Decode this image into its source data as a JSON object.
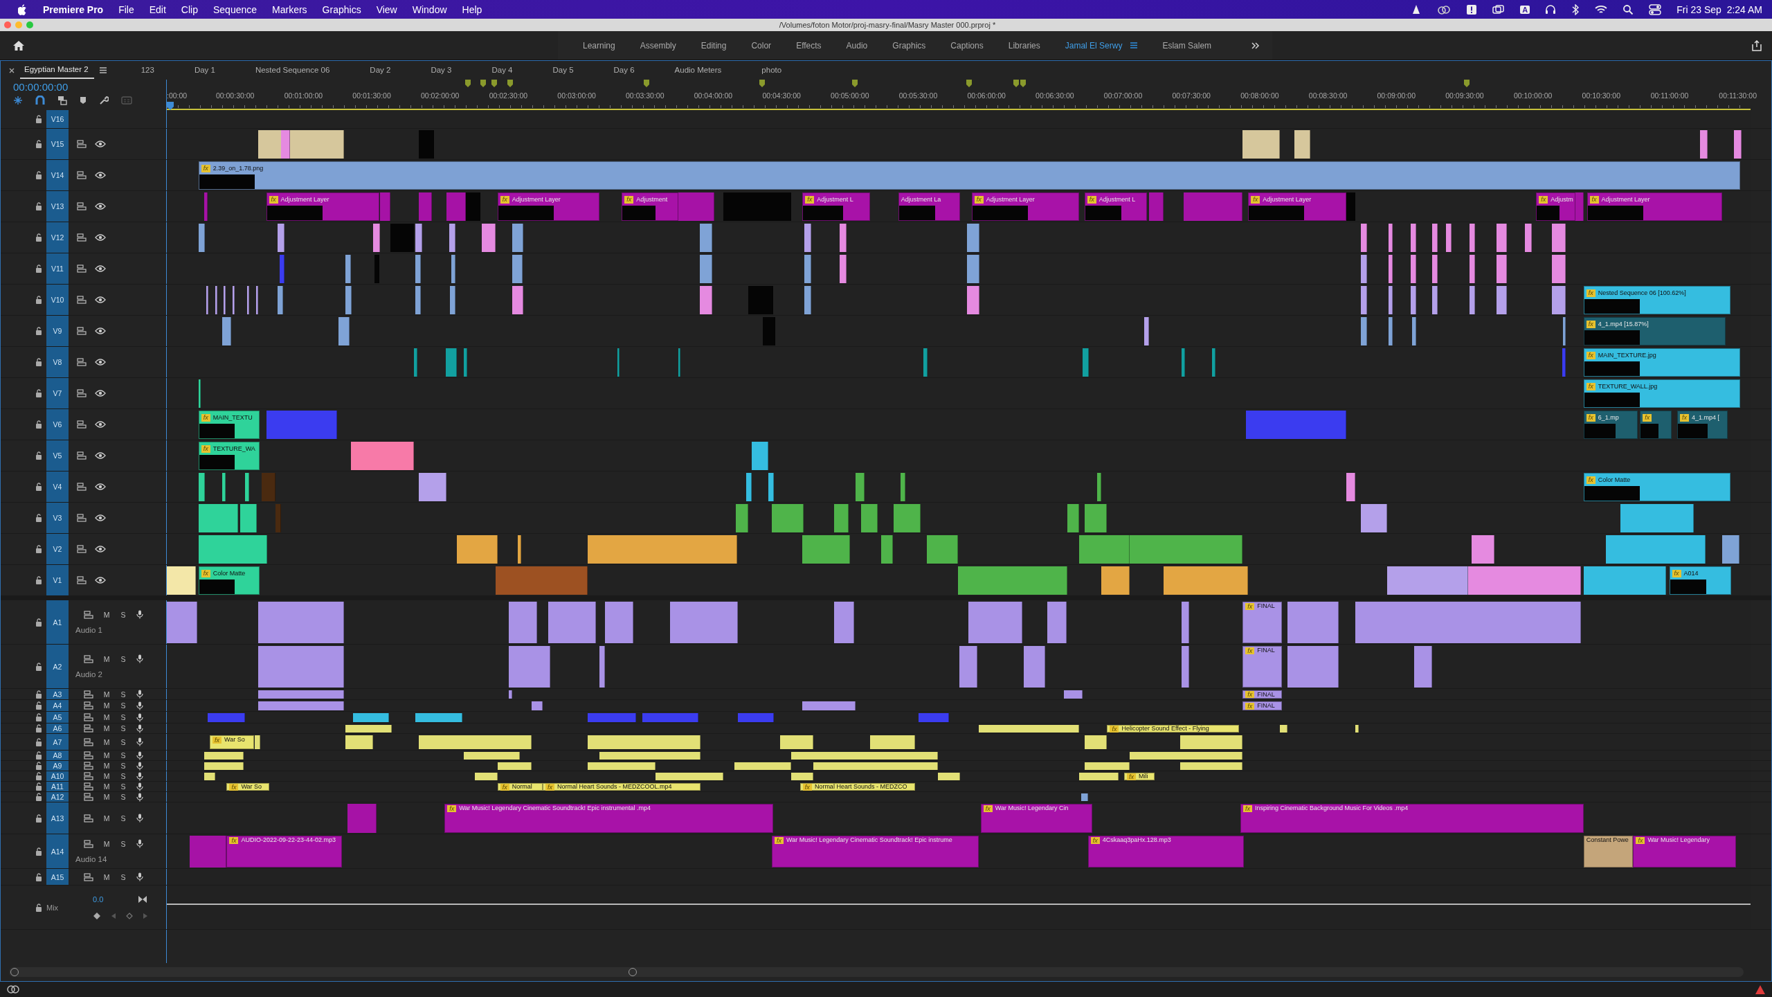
{
  "menu_bar": {
    "app": "Premiere Pro",
    "items": [
      "File",
      "Edit",
      "Clip",
      "Sequence",
      "Markers",
      "Graphics",
      "View",
      "Window",
      "Help"
    ],
    "input_source": "A",
    "clock": "Fri 23 Sep  2:24 AM"
  },
  "window": {
    "title": "/Volumes/foton Motor/proj-masry-final/Masry Master 000.prproj *"
  },
  "workspaces": [
    {
      "label": "Learning",
      "selected": false
    },
    {
      "label": "Assembly",
      "selected": false
    },
    {
      "label": "Editing",
      "selected": false
    },
    {
      "label": "Color",
      "selected": false
    },
    {
      "label": "Effects",
      "selected": false
    },
    {
      "label": "Audio",
      "selected": false
    },
    {
      "label": "Graphics",
      "selected": false
    },
    {
      "label": "Captions",
      "selected": false
    },
    {
      "label": "Libraries",
      "selected": false
    },
    {
      "label": "Jamal El Serwy",
      "selected": true
    },
    {
      "label": "Eslam Salem",
      "selected": false
    }
  ],
  "sequence_tabs": [
    {
      "label": "Egyptian Master 2",
      "selected": true
    },
    {
      "label": "123",
      "selected": false
    },
    {
      "label": "Day 1",
      "selected": false
    },
    {
      "label": "Nested Sequence 06",
      "selected": false
    },
    {
      "label": "Day 2",
      "selected": false
    },
    {
      "label": "Day 3",
      "selected": false
    },
    {
      "label": "Day 4",
      "selected": false
    },
    {
      "label": "Day 5",
      "selected": false
    },
    {
      "label": "Day 6",
      "selected": false
    },
    {
      "label": "Audio Meters",
      "selected": false
    },
    {
      "label": "photo",
      "selected": false
    }
  ],
  "timecode": "00:00:00:00",
  "ruler": [
    ":00:00",
    "00:00:30:00",
    "00:01:00:00",
    "00:01:30:00",
    "00:02:00:00",
    "00:02:30:00",
    "00:03:00:00",
    "00:03:30:00",
    "00:04:00:00",
    "00:04:30:00",
    "00:05:00:00",
    "00:05:30:00",
    "00:06:00:00",
    "00:06:30:00",
    "00:07:00:00",
    "00:07:30:00",
    "00:08:00:00",
    "00:08:30:00",
    "00:09:00:00",
    "00:09:30:00",
    "00:10:00:00",
    "00:10:30:00",
    "00:11:00:00",
    "00:11:30:00"
  ],
  "video_tracks": [
    {
      "label": "V16"
    },
    {
      "label": "V15"
    },
    {
      "label": "V14",
      "clips": [
        {
          "label": "2.39_on_1.78.png",
          "fx": "fx",
          "color": "#7ea1d4"
        }
      ]
    },
    {
      "label": "V13",
      "clips": [
        {
          "label": "Adjustment Layer",
          "fx": "fx",
          "color": "#a812a8"
        },
        {
          "label": "Adjustment Layer",
          "fx": "fx",
          "color": "#a812a8"
        },
        {
          "label": "Adjustment",
          "fx": "fx",
          "color": "#a812a8"
        },
        {
          "label": "Adjustment L",
          "fx": "fx",
          "color": "#a812a8"
        },
        {
          "label": "Adjustment La",
          "color": "#a812a8"
        },
        {
          "label": "Adjustment Layer",
          "fx": "fx",
          "color": "#a812a8"
        },
        {
          "label": "Adjustment L",
          "fx": "fx",
          "color": "#a812a8"
        },
        {
          "label": "Adjustment Layer",
          "fx": "fx",
          "color": "#a812a8"
        },
        {
          "label": "Adjustm",
          "fx": "fx",
          "color": "#a812a8"
        },
        {
          "label": "Adjustment Layer",
          "fx": "fx",
          "color": "#a812a8"
        }
      ]
    },
    {
      "label": "V12"
    },
    {
      "label": "V11"
    },
    {
      "label": "V10",
      "clips": [
        {
          "label": "Nested Sequence 06 [100.62%]",
          "fx": "fx",
          "color": "#35bde0"
        }
      ]
    },
    {
      "label": "V9",
      "clips": [
        {
          "label": "4_1.mp4 [15.87%]",
          "fx": "fx",
          "color": "#1e5f6e"
        }
      ]
    },
    {
      "label": "V8",
      "clips": [
        {
          "label": "MAIN_TEXTURE.jpg",
          "fx": "fx",
          "color": "#35bde0"
        }
      ]
    },
    {
      "label": "V7",
      "clips": [
        {
          "label": "TEXTURE_WALL.jpg",
          "fx": "fx",
          "color": "#35bde0"
        }
      ]
    },
    {
      "label": "V6",
      "clips": [
        {
          "label": "MAIN_TEXTU",
          "fx": "fx",
          "color": "#2fd39a"
        },
        {
          "label": "6_1.mp",
          "fx": "fx",
          "color": "#1e5f6e"
        },
        {
          "fx": "fx",
          "color": "#1e5f6e"
        },
        {
          "label": "4_1.mp4 [",
          "fx": "fx",
          "color": "#1e5f6e"
        }
      ]
    },
    {
      "label": "V5",
      "clips": [
        {
          "label": "TEXTURE_WA",
          "fx": "fx",
          "color": "#2fd39a"
        }
      ]
    },
    {
      "label": "V4",
      "clips": [
        {
          "label": "Color Matte",
          "fx": "fx",
          "color": "#35bde0"
        }
      ]
    },
    {
      "label": "V3"
    },
    {
      "label": "V2"
    },
    {
      "label": "V1",
      "clips": [
        {
          "label": "Color Matte",
          "fx": "fx",
          "color": "#2fd39a"
        },
        {
          "label": "A014",
          "fx": "fx",
          "color": "#35bde0"
        }
      ]
    }
  ],
  "audio_tracks": [
    {
      "label": "A1",
      "name": "Audio 1",
      "mute_button": "M",
      "solo_button": "S",
      "clips": [
        {
          "label": "FINAL",
          "fx": "fx",
          "color": "#a992e6"
        }
      ]
    },
    {
      "label": "A2",
      "name": "Audio 2",
      "mute_button": "M",
      "solo_button": "S",
      "clips": [
        {
          "label": "FINAL",
          "fx": "fx",
          "color": "#a992e6"
        }
      ]
    },
    {
      "label": "A3",
      "mute_button": "M",
      "solo_button": "S",
      "clips": [
        {
          "label": "FINAL",
          "fx": "fx",
          "color": "#a992e6"
        }
      ]
    },
    {
      "label": "A4",
      "mute_button": "M",
      "solo_button": "S",
      "clips": [
        {
          "label": "FINAL",
          "fx": "fx",
          "color": "#a992e6"
        }
      ]
    },
    {
      "label": "A5",
      "mute_button": "M",
      "solo_button": "S"
    },
    {
      "label": "A6",
      "mute_button": "M",
      "solo_button": "S",
      "clips": [
        {
          "label": "Helicopter Sound Effect - Flying",
          "fx": "fx",
          "color": "#e8e46e"
        }
      ]
    },
    {
      "label": "A7",
      "mute_button": "M",
      "solo_button": "S",
      "clips": [
        {
          "label": "War So",
          "fx": "fx",
          "color": "#e8e46e"
        }
      ]
    },
    {
      "label": "A8",
      "mute_button": "M",
      "solo_button": "S"
    },
    {
      "label": "A9",
      "mute_button": "M",
      "solo_button": "S"
    },
    {
      "label": "A10",
      "mute_button": "M",
      "solo_button": "S",
      "clips": [
        {
          "label": "Mili",
          "fx": "fx",
          "color": "#e8e46e"
        }
      ]
    },
    {
      "label": "A11",
      "mute_button": "M",
      "solo_button": "S",
      "clips": [
        {
          "label": "War So",
          "fx": "fx",
          "color": "#e8e46e"
        },
        {
          "label": "Normal",
          "fx": "fx",
          "color": "#e8e46e"
        },
        {
          "label": "Normal Heart Sounds - MEDZCOOL.mp4",
          "fx": "fx",
          "color": "#e8e46e"
        },
        {
          "label": "Normal Heart Sounds - MEDZCO",
          "fx": "fx",
          "color": "#e8e46e"
        }
      ]
    },
    {
      "label": "A12",
      "mute_button": "M",
      "solo_button": "S"
    },
    {
      "label": "A13",
      "mute_button": "M",
      "solo_button": "S",
      "clips": [
        {
          "label": "War Music! Legendary Cinematic Soundtrack! Epic instrumental .mp4",
          "fx": "fx",
          "color": "#a812a8"
        },
        {
          "label": "War Music! Legendary Cin",
          "fx": "fx",
          "color": "#a812a8"
        },
        {
          "label": "Inspiring Cinematic Background Music For Videos .mp4",
          "fx": "fx",
          "color": "#a812a8"
        }
      ]
    },
    {
      "label": "A14",
      "name": "Audio 14",
      "mute_button": "M",
      "solo_button": "S",
      "clips": [
        {
          "label": "AUDIO-2022-09-22-23-44-02.mp3",
          "fx": "fx",
          "color": "#a812a8"
        },
        {
          "label": "War Music! Legendary Cinematic Soundtrack! Epic instrume",
          "fx": "fx",
          "color": "#a812a8"
        },
        {
          "label": "4Cskaaq3paHx.128.mp3",
          "fx": "fx",
          "color": "#a812a8"
        },
        {
          "label": "Constant Powe",
          "color": "#c4a57a"
        },
        {
          "label": "War Music! Legendary",
          "fx": "fx",
          "color": "#a812a8"
        }
      ]
    },
    {
      "label": "A15",
      "mute_button": "M",
      "solo_button": "S"
    }
  ],
  "mix": {
    "label": "Mix",
    "value": "0.0"
  }
}
